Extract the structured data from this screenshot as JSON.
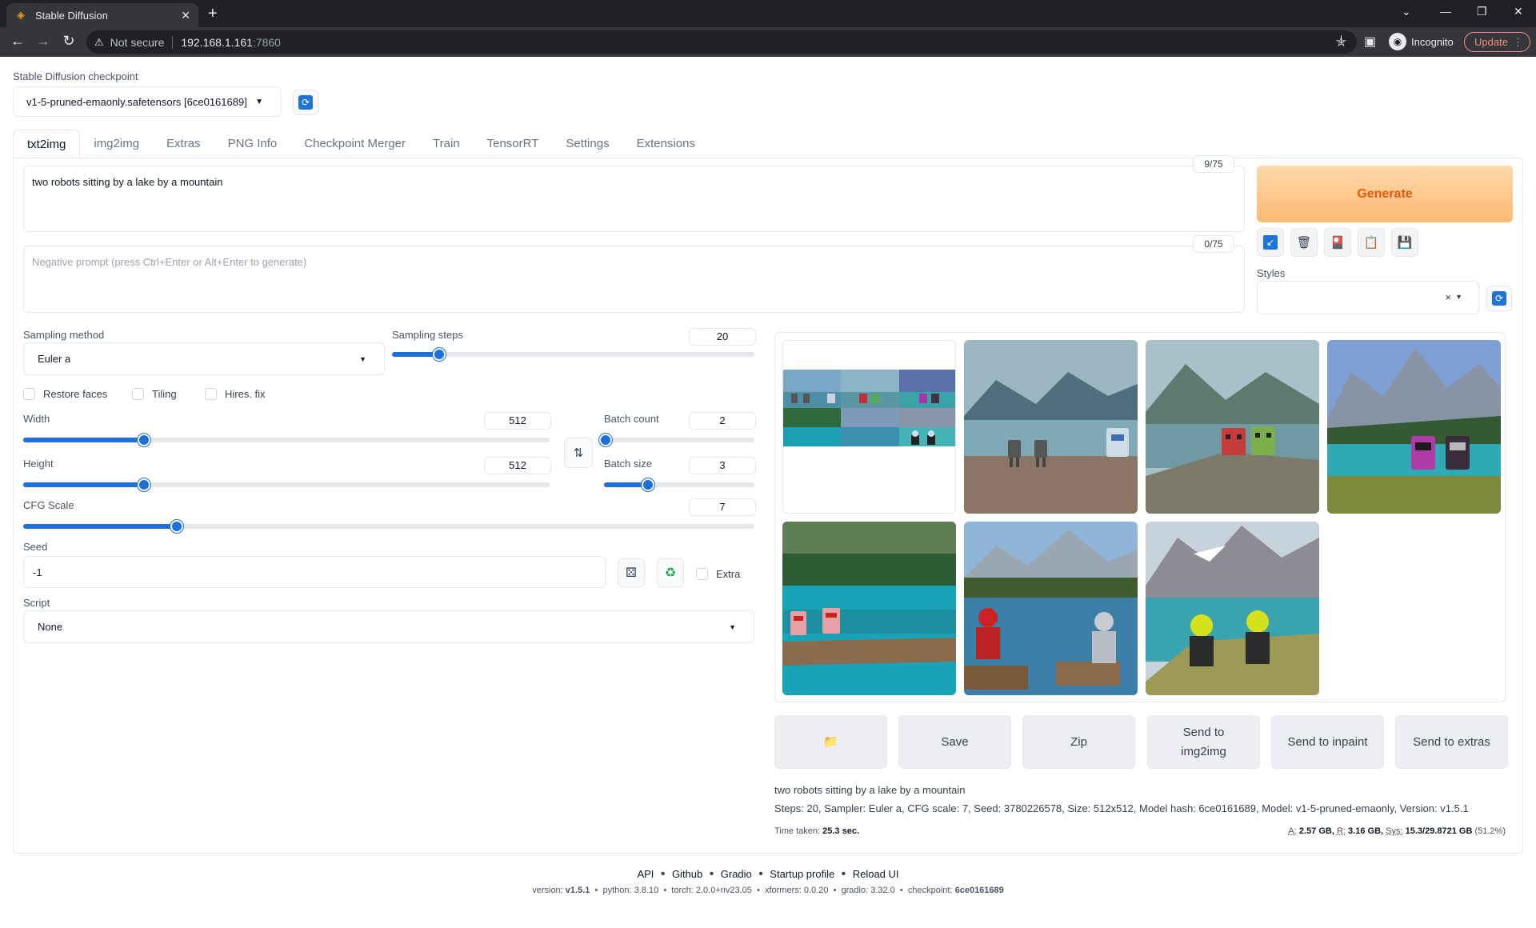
{
  "browser": {
    "tab_title": "Stable Diffusion",
    "new_tab": "+",
    "not_secure": "Not secure",
    "url_host": "192.168.1.161",
    "url_port": ":7860",
    "incognito": "Incognito",
    "update": "Update"
  },
  "checkpoint": {
    "label": "Stable Diffusion checkpoint",
    "value": "v1-5-pruned-emaonly.safetensors [6ce0161689]"
  },
  "tabs": [
    "txt2img",
    "img2img",
    "Extras",
    "PNG Info",
    "Checkpoint Merger",
    "Train",
    "TensorRT",
    "Settings",
    "Extensions"
  ],
  "prompt": {
    "text": "two robots sitting by a lake by a mountain",
    "counter": "9/75",
    "negative_placeholder": "Negative prompt (press Ctrl+Enter or Alt+Enter to generate)",
    "negative_counter": "0/75"
  },
  "generate_label": "Generate",
  "styles_label": "Styles",
  "styles_clear": "×",
  "sampling": {
    "method_label": "Sampling method",
    "method_value": "Euler a",
    "steps_label": "Sampling steps",
    "steps_value": "20",
    "steps_fraction": 0.13
  },
  "checkboxes": {
    "restore_faces": "Restore faces",
    "tiling": "Tiling",
    "hires_fix": "Hires. fix",
    "extra": "Extra"
  },
  "width": {
    "label": "Width",
    "value": "512",
    "fraction": 0.23
  },
  "height": {
    "label": "Height",
    "value": "512",
    "fraction": 0.23
  },
  "batch_count": {
    "label": "Batch count",
    "value": "2",
    "fraction": 0.01
  },
  "batch_size": {
    "label": "Batch size",
    "value": "3",
    "fraction": 0.29
  },
  "cfg": {
    "label": "CFG Scale",
    "value": "7",
    "fraction": 0.21
  },
  "seed": {
    "label": "Seed",
    "value": "-1"
  },
  "script": {
    "label": "Script",
    "value": "None"
  },
  "actions": {
    "folder": "folder-icon",
    "save": "Save",
    "zip": "Zip",
    "send_img2img_1": "Send to",
    "send_img2img_2": "img2img",
    "send_inpaint": "Send to inpaint",
    "send_extras": "Send to extras"
  },
  "output": {
    "prompt": "two robots sitting by a lake by a mountain",
    "params": "Steps: 20, Sampler: Euler a, CFG scale: 7, Seed: 3780226578, Size: 512x512, Model hash: 6ce0161689, Model: v1-5-pruned-emaonly, Version: v1.5.1",
    "time_label": "Time taken:",
    "time_value": "25.3 sec.",
    "mem_a_label": "A:",
    "mem_a": "2.57 GB,",
    "mem_r_label": "R:",
    "mem_r": "3.16 GB,",
    "mem_sys_label": "Sys:",
    "mem_sys": "15.3/29.8721 GB",
    "mem_pct": "(51.2%)"
  },
  "footer": {
    "links": [
      "API",
      "Github",
      "Gradio",
      "Startup profile",
      "Reload UI"
    ],
    "version": "version: ",
    "version_v": "v1.5.1",
    "python": "python: 3.8.10",
    "torch": "torch: 2.0.0+nv23.05",
    "xformers": "xformers: 0.0.20",
    "gradio": "gradio: 3.32.0",
    "checkpoint_label": "checkpoint: ",
    "checkpoint_v": "6ce0161689"
  },
  "colors": {
    "accent": "#1d6fe0",
    "generate_text": "#ea580c",
    "generate_bg": "#fdba74"
  }
}
